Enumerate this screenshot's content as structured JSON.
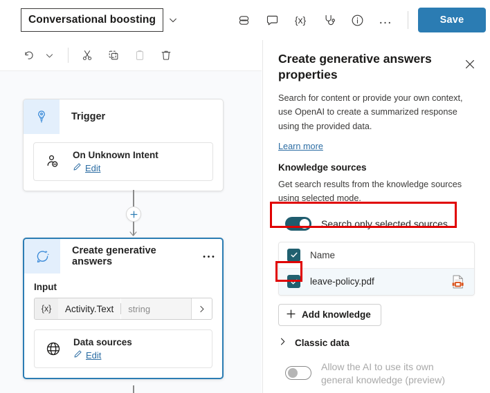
{
  "topbar": {
    "flow_title": "Conversational boosting",
    "title_chevron_icon": "chevron-down-icon",
    "icons": [
      {
        "name": "copilot-icon",
        "label": "Copilot"
      },
      {
        "name": "comment-icon",
        "label": "Comments"
      },
      {
        "name": "variables-icon",
        "label": "{x}"
      },
      {
        "name": "test-stethoscope-icon",
        "label": "Test"
      },
      {
        "name": "info-icon",
        "label": "Information"
      },
      {
        "name": "more-options-icon",
        "label": "..."
      }
    ],
    "save_label": "Save"
  },
  "subtoolbar": {
    "icons": [
      {
        "name": "undo-icon",
        "label": "Undo",
        "disabled": false
      },
      {
        "name": "undo-chevron-icon",
        "label": "Undo history",
        "disabled": false
      },
      {
        "name": "cut-icon",
        "label": "Cut",
        "disabled": false
      },
      {
        "name": "copy-icon",
        "label": "Copy",
        "disabled": false
      },
      {
        "name": "paste-icon",
        "label": "Paste",
        "disabled": true
      },
      {
        "name": "delete-icon",
        "label": "Delete",
        "disabled": false
      }
    ]
  },
  "canvas": {
    "trigger_node": {
      "icon": "trigger-bulb-icon",
      "title": "Trigger",
      "card": {
        "icon": "unknown-intent-person-icon",
        "title": "On Unknown Intent",
        "edit_label": "Edit",
        "edit_icon": "pencil-icon"
      }
    },
    "connector": {
      "plus_icon": "add-node-plus-icon"
    },
    "answers_node": {
      "icon": "generative-answers-sparkle-icon",
      "title": "Create generative answers",
      "more_icon": "node-more-options-icon",
      "input_label": "Input",
      "input_row": {
        "var_icon": "{x}",
        "name": "Activity.Text",
        "type": "string",
        "chevron_icon": "chevron-right-icon"
      },
      "card": {
        "icon": "globe-data-sources-icon",
        "title": "Data sources",
        "edit_label": "Edit",
        "edit_icon": "pencil-icon"
      }
    }
  },
  "panel": {
    "title": "Create generative answers properties",
    "close_icon": "close-icon",
    "description": "Search for content or provide your own context, use OpenAI to create a summarized response using the provided data.",
    "learn_more": "Learn more",
    "knowledge_heading": "Knowledge sources",
    "knowledge_sub": "Get search results from the knowledge sources using selected mode.",
    "search_toggle": {
      "label": "Search only selected sources",
      "on": true
    },
    "table": {
      "header": {
        "checkbox_checked": true,
        "name": "Name"
      },
      "rows": [
        {
          "checkbox_checked": true,
          "name": "leave-policy.pdf",
          "file_icon": "pdf-file-icon"
        }
      ]
    },
    "add_knowledge": {
      "label": "Add knowledge",
      "icon": "plus-icon"
    },
    "classic_data": {
      "label": "Classic data",
      "icon": "chevron-right-icon",
      "expanded": false
    },
    "general_knowledge_toggle": {
      "label": "Allow the AI to use its own general knowledge (preview)",
      "on": false,
      "disabled": true
    }
  },
  "annotations": {
    "highlight_color": "#e00000",
    "boxes": [
      {
        "name": "search-toggle-highlight"
      },
      {
        "name": "row-checkbox-highlight"
      }
    ]
  },
  "colors": {
    "accent_blue": "#2b7cb3",
    "toggle_on": "#1f5c6e",
    "checkbox": "#20606f",
    "node_icon_bg": "#e3effc",
    "canvas_bg": "#f9fafc",
    "pdf_orange": "#d9541e"
  }
}
